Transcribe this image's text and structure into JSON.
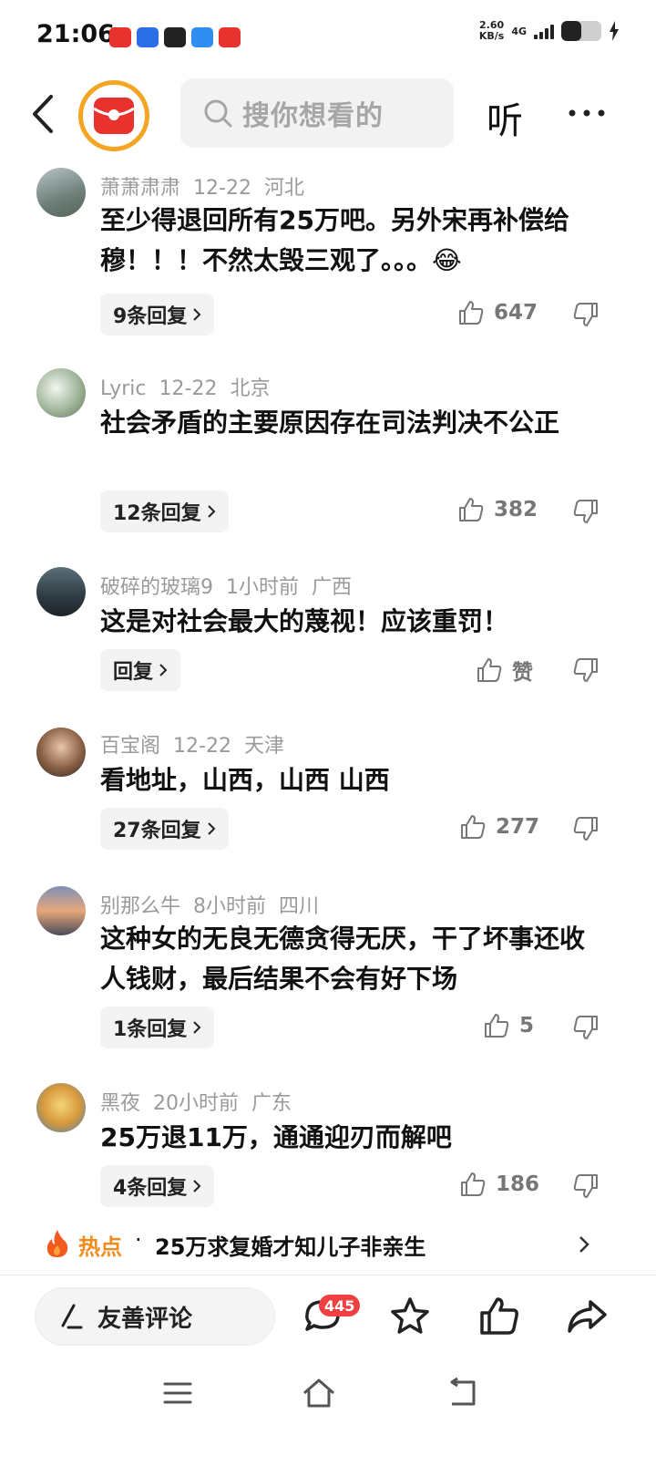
{
  "status_bar": {
    "time": "21:06",
    "net_speed_value": "2.60",
    "net_speed_unit": "KB/s",
    "net_type": "4G"
  },
  "header": {
    "search_placeholder": "搜你想看的",
    "listen_label": "听"
  },
  "comments": [
    {
      "user": "萧萧肃肃",
      "date": "12-22",
      "location": "河北",
      "text": "至少得退回所有25万吧。另外宋再补偿给穆！！！不然太毁三观了。。。😂",
      "reply_label": "9条回复",
      "likes": "647"
    },
    {
      "user": "Lyric",
      "date": "12-22",
      "location": "北京",
      "text": "社会矛盾的主要原因存在司法判决不公正",
      "reply_label": "12条回复",
      "likes": "382"
    },
    {
      "user": "破碎的玻璃9",
      "date": "1小时前",
      "location": "广西",
      "text": "这是对社会最大的蔑视！应该重罚！",
      "reply_label": "回复",
      "likes": "赞"
    },
    {
      "user": "百宝阁",
      "date": "12-22",
      "location": "天津",
      "text": "看地址，山西，山西 山西",
      "reply_label": "27条回复",
      "likes": "277"
    },
    {
      "user": "别那么牛",
      "date": "8小时前",
      "location": "四川",
      "text": "这种女的无良无德贪得无厌，干了坏事还收人钱财，最后结果不会有好下场",
      "reply_label": "1条回复",
      "likes": "5"
    },
    {
      "user": "黑夜",
      "date": "20小时前",
      "location": "广东",
      "text": "25万退11万，通通迎刃而解吧",
      "reply_label": "4条回复",
      "likes": "186"
    }
  ],
  "hot": {
    "label": "热点",
    "dot": "·",
    "title": "25万求复婚才知儿子非亲生"
  },
  "action_bar": {
    "comment_placeholder": "友善评论",
    "comment_count": "445"
  },
  "colors": {
    "accent_orange": "#f28b1e",
    "badge_red": "#f04142",
    "brand_red": "#e8322e"
  }
}
